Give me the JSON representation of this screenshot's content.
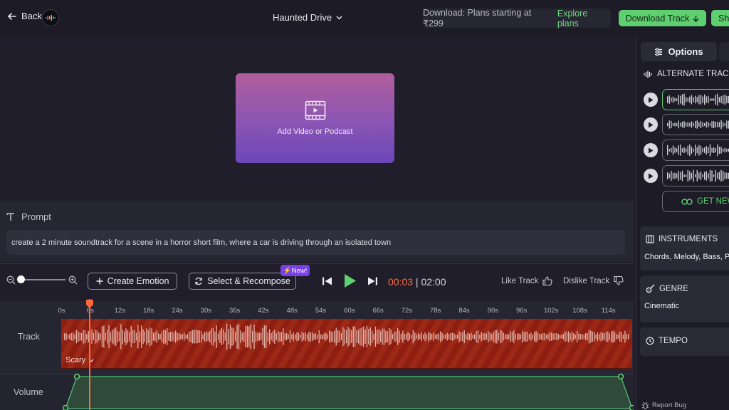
{
  "header": {
    "back_label": "Back",
    "project_title": "Haunted Drive",
    "promo_text": "Download: Plans starting at ₹299",
    "promo_link": "Explore plans",
    "download_label": "Download Track",
    "share_label": "Sh",
    "icons": {
      "back": "arrow-left-icon",
      "logo": "app-logo",
      "project": "chevron-down-icon",
      "download": "arrow-down-icon"
    }
  },
  "video": {
    "add_label": "Add Video or Podcast",
    "icon": "video-icon"
  },
  "prompt": {
    "label": "Prompt",
    "text": "create a 2 minute soundtrack for a scene in a horror short film, where a car is driving through an isolated town"
  },
  "controls": {
    "create_emotion_label": "Create Emotion",
    "recompose_label": "Select & Recompose",
    "new_badge": "⚡New!",
    "time_current": "00:03",
    "time_separator": " | ",
    "time_total": "02:00",
    "like_label": "Like Track",
    "dislike_label": "Dislike Track"
  },
  "timeline": {
    "ticks": [
      "0s",
      "6s",
      "12s",
      "18s",
      "24s",
      "30s",
      "36s",
      "42s",
      "48s",
      "54s",
      "60s",
      "66s",
      "72s",
      "78s",
      "84s",
      "90s",
      "96s",
      "102s",
      "108s",
      "114s"
    ],
    "track_label": "Track",
    "emotion_tag": "Scary",
    "volume_label": "Volume",
    "playhead_seconds": 3,
    "total_seconds": 120
  },
  "panel": {
    "options_tab": "Options",
    "alt_header": "ALTERNATE TRACK",
    "alt_tracks": [
      {
        "selected": true
      },
      {
        "selected": false
      },
      {
        "selected": false
      },
      {
        "selected": false
      }
    ],
    "get_new_label": "GET NEW",
    "instruments_title": "INSTRUMENTS",
    "instruments_value": "Chords, Melody, Bass, P",
    "genre_title": "GENRE",
    "genre_value": "Cinematic",
    "tempo_title": "TEMPO",
    "report_bug": "Report Bug"
  },
  "colors": {
    "accent_green": "#5fd070",
    "playhead_orange": "#ff6a3d",
    "track_red": "#8f1e12",
    "badge_purple": "#7a3fe6"
  }
}
